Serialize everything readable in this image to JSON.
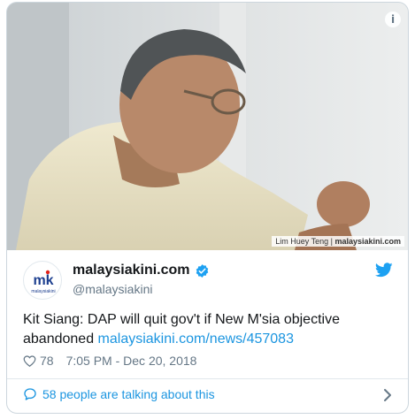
{
  "media": {
    "photo_credit_name": "Lim Huey Teng",
    "photo_credit_separator": " | ",
    "photo_credit_source": "malaysiakini.com",
    "info_icon_glyph": "i"
  },
  "author": {
    "display_name": "malaysiakini.com",
    "handle": "@malaysiakini",
    "avatar_text": "mk",
    "avatar_subtext": "malaysiakini",
    "verified_icon": "verified-badge-icon",
    "platform_icon": "twitter-bird-icon"
  },
  "tweet": {
    "text": "Kit Siang: DAP will quit gov't if New M'sia objective abandoned ",
    "link_text": "malaysiakini.com/news/457083"
  },
  "meta": {
    "like_count": "78",
    "timestamp": "7:05 PM - Dec 20, 2018"
  },
  "footer": {
    "talking_text": "58 people are talking about this"
  },
  "colors": {
    "accent": "#1b95e0",
    "twitter_blue": "#1da1f2",
    "muted": "#657786",
    "border": "#e1e8ed"
  }
}
